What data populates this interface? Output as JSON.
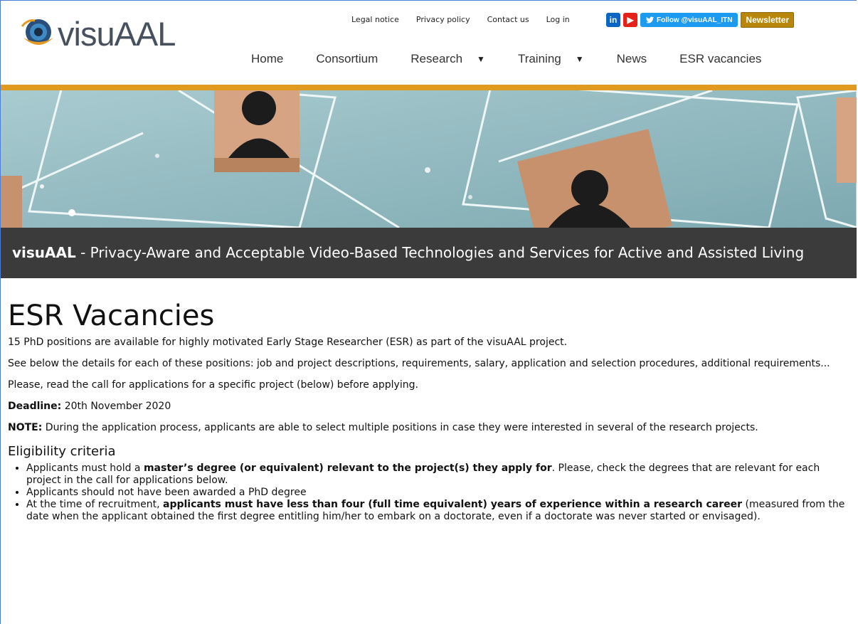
{
  "header": {
    "logo_text": "visuAAL",
    "util_nav": [
      "Legal notice",
      "Privacy policy",
      "Contact us",
      "Log in"
    ],
    "social": {
      "linkedin_label": "in",
      "youtube_label": "▶",
      "twitter_label": "Follow @visuAAL_ITN",
      "newsletter_label": "Newsletter"
    },
    "main_nav": [
      {
        "label": "Home",
        "has_dropdown": false
      },
      {
        "label": "Consortium",
        "has_dropdown": false
      },
      {
        "label": "Research",
        "has_dropdown": true
      },
      {
        "label": "Training",
        "has_dropdown": true
      },
      {
        "label": "News",
        "has_dropdown": false
      },
      {
        "label": "ESR vacancies",
        "has_dropdown": false
      }
    ],
    "accent_color": "#df9a1f"
  },
  "banner": {
    "title_bold": "visuAAL",
    "title_rest": " - Privacy-Aware and Acceptable Video-Based Technologies and Services for Active and Assisted Living"
  },
  "main": {
    "page_title": "ESR Vacancies",
    "intro": "15 PhD positions are available for highly motivated Early Stage Researcher (ESR) as part of the visuAAL project.",
    "details": "See below the details for each of these positions: job and project descriptions, requirements, salary, application and selection procedures, additional requirements...",
    "read_call": "Please, read the call for applications for a specific project (below) before applying.",
    "deadline_label": "Deadline:",
    "deadline_value": " 20th November 2020",
    "note_label": "NOTE:",
    "note_value": " During the application process, applicants are able to select multiple positions in case they were interested in several of the research projects.",
    "eligibility_title": "Eligibility criteria",
    "eligibility": [
      {
        "pre": "Applicants must hold a ",
        "bold": "master’s degree (or equivalent) relevant to the project(s) they apply for",
        "post": ". Please, check the degrees that are relevant for each project in the call for applications below."
      },
      {
        "pre": "Applicants should not have been awarded a PhD degree",
        "bold": "",
        "post": ""
      },
      {
        "pre": "At the time of recruitment, ",
        "bold": "applicants must have less than four (full time equivalent) years of experience within a research career",
        "post": " (measured from the date when the applicant obtained the first degree entitling him/her to embark on a doctorate, even if a doctorate was never started or envisaged)."
      }
    ]
  }
}
